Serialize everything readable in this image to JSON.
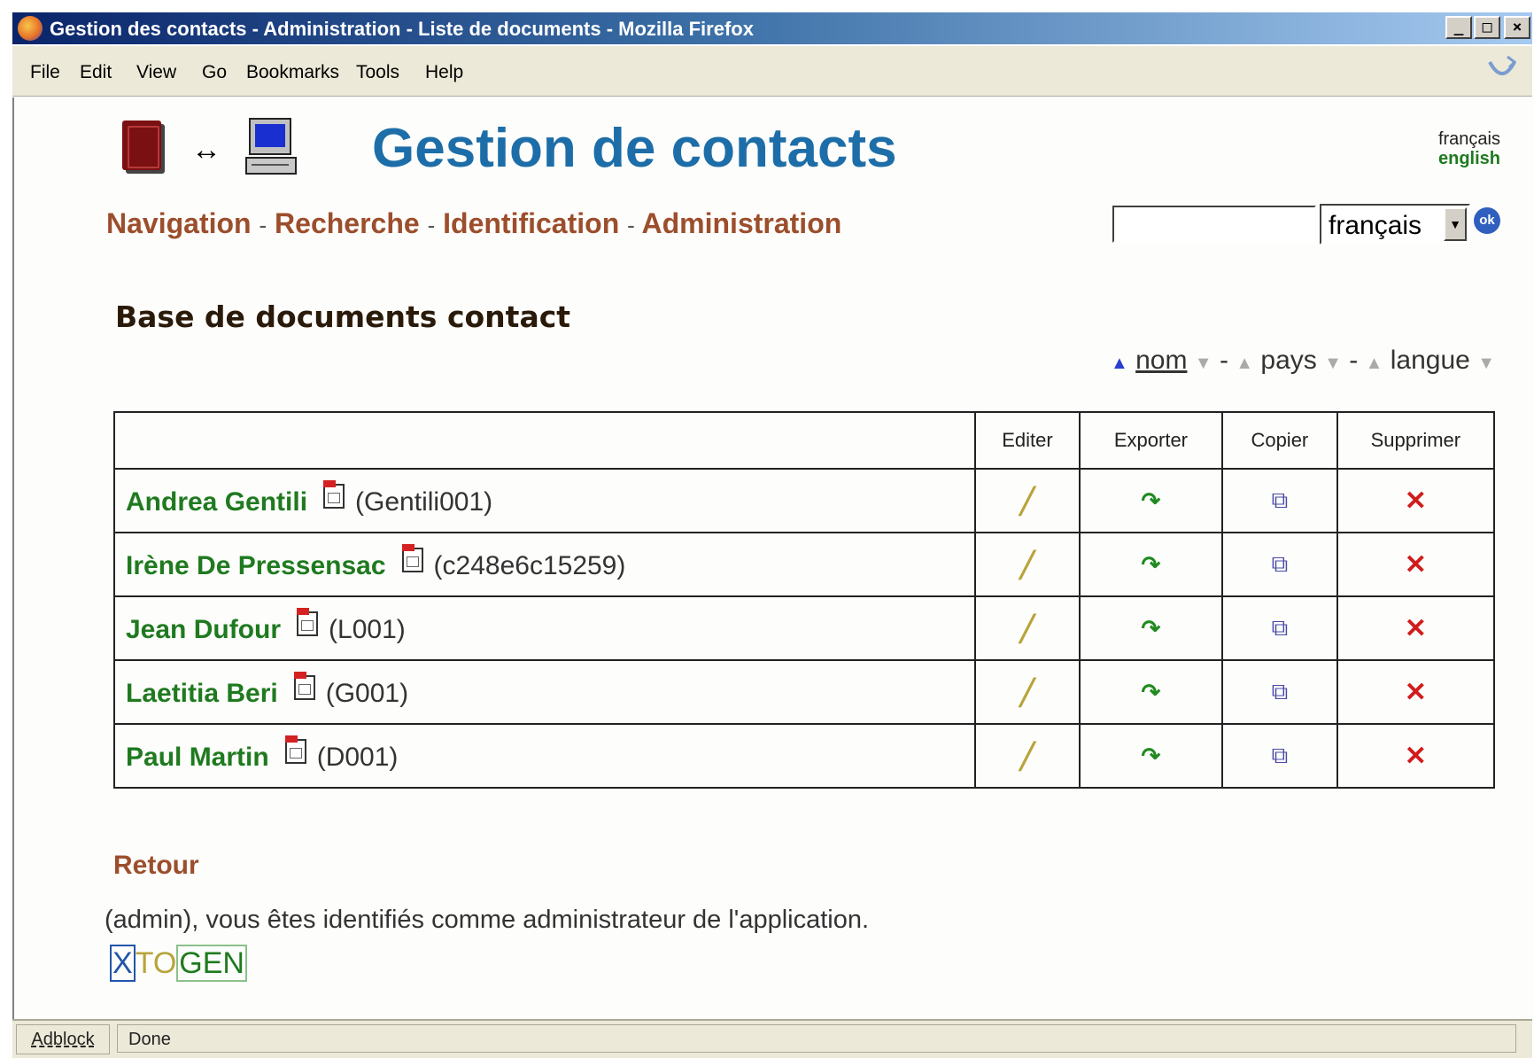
{
  "window": {
    "title": "Gestion des contacts - Administration - Liste de documents - Mozilla Firefox",
    "buttons": {
      "minimize": "_",
      "maximize": "□",
      "close": "×"
    }
  },
  "menu": {
    "items": [
      "File",
      "Edit",
      "View",
      "Go",
      "Bookmarks",
      "Tools",
      "Help"
    ]
  },
  "header": {
    "title": "Gestion de contacts",
    "logo_arrow": "↔",
    "lang_links": {
      "fr": "français",
      "en": "english"
    }
  },
  "nav": {
    "items": [
      "Navigation",
      "Recherche",
      "Identification",
      "Administration"
    ],
    "separator": "-"
  },
  "search": {
    "value": "",
    "lang_select": "français",
    "ok_label": "ok"
  },
  "section": {
    "title": "Base de documents contact"
  },
  "sort": {
    "nom": "nom",
    "pays": "pays",
    "langue": "langue",
    "separator": "-"
  },
  "table": {
    "headers": [
      "",
      "Editer",
      "Exporter",
      "Copier",
      "Supprimer"
    ],
    "rows": [
      {
        "name": "Andrea Gentili",
        "id": "(Gentili001)"
      },
      {
        "name": "Irène De Pressensac",
        "id": "(c248e6c15259)"
      },
      {
        "name": "Jean Dufour",
        "id": "(L001)"
      },
      {
        "name": "Laetitia Beri",
        "id": "(G001)"
      },
      {
        "name": "Paul Martin",
        "id": "(D001)"
      }
    ],
    "icons": {
      "edit": "pencil-icon",
      "export": "export-arrow-icon",
      "copy": "copy-icon",
      "delete": "delete-icon"
    }
  },
  "footer": {
    "retour": "Retour",
    "admin_message": "(admin), vous êtes identifiés comme administrateur de l'application.",
    "logo": {
      "x": "X",
      "to": "TO",
      "gen": "GEN"
    }
  },
  "statusbar": {
    "adblock": "Adblock",
    "status": "Done"
  },
  "colors": {
    "heading": "#1d6ea8",
    "nav": "#9c4e2c",
    "name_link": "#1f7a1f",
    "delete": "#d11c1c"
  }
}
